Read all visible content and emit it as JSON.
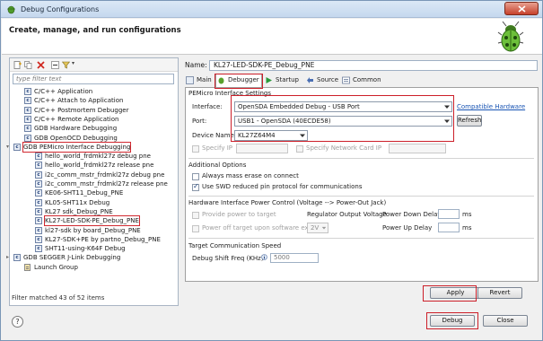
{
  "window": {
    "title": "Debug Configurations"
  },
  "header": {
    "title": "Create, manage, and run configurations"
  },
  "filter": {
    "placeholder": "type filter text",
    "status": "Filter matched 43 of 52 items"
  },
  "tree": [
    {
      "label": "C/C++ Application",
      "icon": "c-config-icon"
    },
    {
      "label": "C/C++ Attach to Application",
      "icon": "c-config-icon"
    },
    {
      "label": "C/C++ Postmortem Debugger",
      "icon": "c-config-icon"
    },
    {
      "label": "C/C++ Remote Application",
      "icon": "c-config-icon"
    },
    {
      "label": "GDB Hardware Debugging",
      "icon": "c-config-icon"
    },
    {
      "label": "GDB OpenOCD Debugging",
      "icon": "c-config-icon"
    },
    {
      "label": "GDB PEMicro Interface Debugging",
      "icon": "c-config-icon"
    },
    {
      "label": "hello_world_frdmkl27z debug pne",
      "icon": "c-config-icon"
    },
    {
      "label": "hello_world_frdmkl27z release pne",
      "icon": "c-config-icon"
    },
    {
      "label": "i2c_comm_mstr_frdmkl27z debug pne",
      "icon": "c-config-icon"
    },
    {
      "label": "i2c_comm_mstr_frdmkl27z release pne",
      "icon": "c-config-icon"
    },
    {
      "label": "KE06-SHT11_Debug_PNE",
      "icon": "c-config-icon"
    },
    {
      "label": "KL05-SHT11x Debug",
      "icon": "c-config-icon"
    },
    {
      "label": "KL27 sdk_Debug_PNE",
      "icon": "c-config-icon"
    },
    {
      "label": "KL27-LED-SDK-PE_Debug_PNE",
      "icon": "c-config-icon"
    },
    {
      "label": "kl27-sdk by board_Debug_PNE",
      "icon": "c-config-icon"
    },
    {
      "label": "KL27-SDK+PE by partno_Debug_PNE",
      "icon": "c-config-icon"
    },
    {
      "label": "SHT11-using-K64F Debug",
      "icon": "c-config-icon"
    },
    {
      "label": "GDB SEGGER J-Link Debugging",
      "icon": "c-config-icon"
    },
    {
      "label": "Launch Group",
      "icon": "launch-group-icon"
    }
  ],
  "name": {
    "label": "Name:",
    "value": "KL27-LED-SDK-PE_Debug_PNE"
  },
  "tabs": [
    "Main",
    "Debugger",
    "Startup",
    "Source",
    "Common"
  ],
  "pemicro": {
    "section": "PEMicro Interface Settings",
    "interface_label": "Interface:",
    "interface_value": "OpenSDA Embedded Debug - USB Port",
    "compatible_link": "Compatible Hardware",
    "port_label": "Port:",
    "port_value": "USB1 - OpenSDA (40ECDE58)",
    "refresh": "Refresh",
    "device_label": "Device Name",
    "device_value": "KL27Z64M4",
    "specify_ip": "Specify IP",
    "specify_card_ip": "Specify Network Card IP"
  },
  "additional": {
    "section": "Additional Options",
    "mass_erase": "Always mass erase on connect",
    "swd": "Use SWD reduced pin protocol for communications"
  },
  "power": {
    "section": "Hardware Interface Power Control (Voltage --> Power-Out Jack)",
    "provide": "Provide power to target",
    "regulator": "Regulator Output Voltage",
    "down_delay": "Power Down Delay",
    "ms": "ms",
    "power_off": "Power off target upon software exit",
    "voltage": "2V",
    "up_delay": "Power Up Delay"
  },
  "comm": {
    "section": "Target Communication Speed",
    "shift_label": "Debug Shift Freq (KHz)",
    "shift_value": "5000"
  },
  "buttons": {
    "apply": "Apply",
    "revert": "Revert",
    "debug": "Debug",
    "close": "Close"
  },
  "colors": {
    "highlight": "#cc1f29",
    "link": "#1a55b4",
    "title": "#dbe8f6"
  }
}
